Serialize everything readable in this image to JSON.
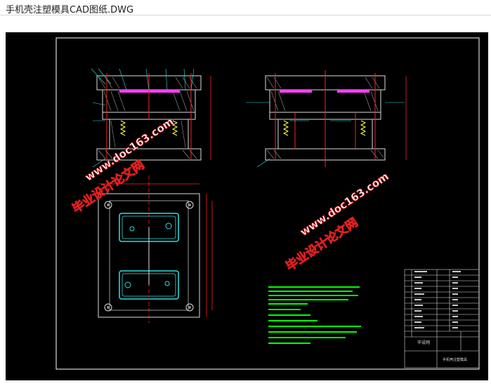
{
  "window": {
    "title": "手机壳注塑模具CAD图纸.DWG"
  },
  "drawing": {
    "watermark_text": "毕业设计论文网",
    "watermark_url": "www.doc163.com",
    "title_block": {
      "company": "毕设网",
      "drawing_name": "手机壳注塑模具"
    },
    "colors": {
      "background": "#000000",
      "frame": "#ffffff",
      "red": "#ff2020",
      "green": "#00ff00",
      "cyan": "#30e0e0",
      "magenta": "#ff40ff",
      "yellow": "#ffff40",
      "watermark": "#e8e8e8"
    }
  }
}
